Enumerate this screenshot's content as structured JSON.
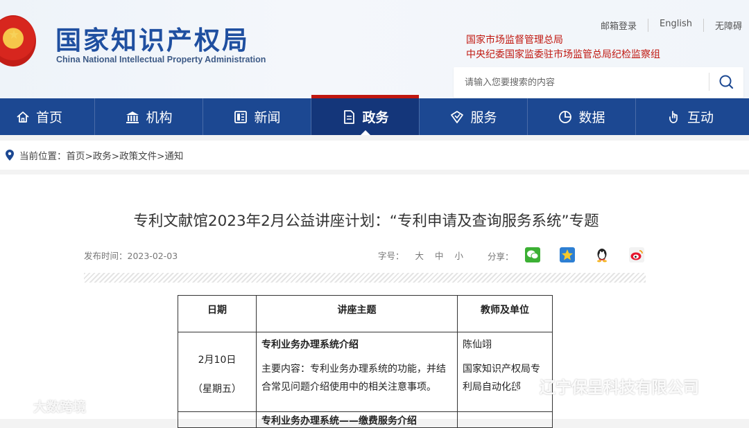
{
  "header": {
    "logo_cn": "国家知识产权局",
    "logo_en": "China National Intellectual Property Administration",
    "top_links": [
      "邮箱登录",
      "English",
      "无障碍"
    ],
    "red_links": [
      "国家市场监督管理总局",
      "中央纪委国家监委驻市场监管总局纪检监察组"
    ],
    "search_placeholder": "请输入您要搜索的内容"
  },
  "nav": {
    "items": [
      {
        "label": "首页",
        "icon": "home-icon"
      },
      {
        "label": "机构",
        "icon": "institution-icon"
      },
      {
        "label": "新闻",
        "icon": "news-icon"
      },
      {
        "label": "政务",
        "icon": "document-icon",
        "active": true
      },
      {
        "label": "服务",
        "icon": "service-icon"
      },
      {
        "label": "数据",
        "icon": "pie-chart-icon"
      },
      {
        "label": "互动",
        "icon": "hand-pointer-icon"
      }
    ]
  },
  "breadcrumb": {
    "prefix": "当前位置：",
    "path": "首页>政务>政策文件>通知"
  },
  "article": {
    "title": "专利文献馆2023年2月公益讲座计划：“专利申请及查询服务系统”专题",
    "publish_time": "发布时间：2023-02-03",
    "font_size_label": "字号：",
    "font_sizes": [
      "大",
      "中",
      "小"
    ],
    "share_label": "分享：",
    "share_icons": [
      "wechat-icon",
      "qzone-star-icon",
      "qq-penguin-icon",
      "weibo-icon"
    ]
  },
  "table": {
    "headers": [
      "日期",
      "讲座主题",
      "教师及单位"
    ],
    "rows": [
      {
        "date": "2月10日",
        "weekday": "（星期五）",
        "topic_title": "专利业务办理系统介绍",
        "topic_desc": "主要内容：专利业务办理系统的功能，并结合常见问题介绍使用中的相关注意事项。",
        "teacher": "陈仙翊",
        "unit": "国家知识产权局专利局自动化部"
      },
      {
        "date": "",
        "topic_title": "专利业务办理系统——缴费服务介绍",
        "teacher": ""
      }
    ]
  },
  "watermarks": {
    "left": "大数跨境",
    "right": "辽宁保呈科技有限公司"
  },
  "colors": {
    "nav_bg": "#1c4892",
    "nav_active": "#14367a",
    "accent_red": "#c0170f",
    "logo_blue": "#1f4fa0"
  }
}
